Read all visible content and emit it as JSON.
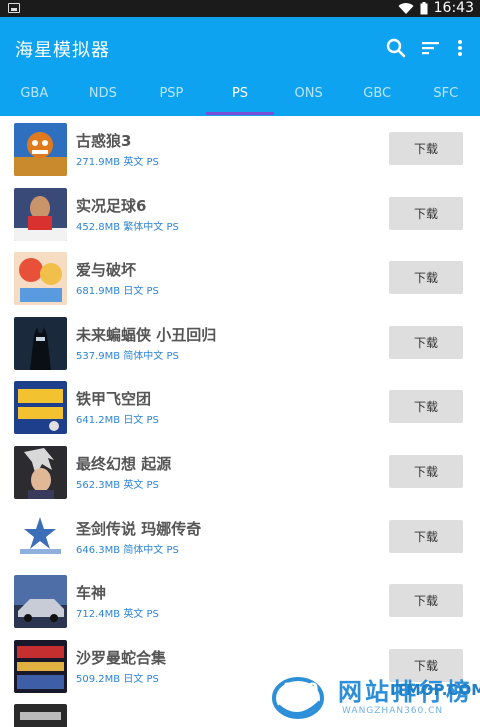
{
  "status_bar": {
    "time": "16:43"
  },
  "app_bar": {
    "title": "海星模拟器"
  },
  "tabs": [
    {
      "label": "GBA",
      "active": false
    },
    {
      "label": "NDS",
      "active": false
    },
    {
      "label": "PSP",
      "active": false
    },
    {
      "label": "PS",
      "active": true
    },
    {
      "label": "ONS",
      "active": false
    },
    {
      "label": "GBC",
      "active": false
    },
    {
      "label": "SFC",
      "active": false
    }
  ],
  "games": [
    {
      "name": "古惑狼3",
      "size": "271.9MB",
      "lang": "英文",
      "platform": "PS",
      "button": "下载"
    },
    {
      "name": "实况足球6",
      "size": "452.8MB",
      "lang": "繁体中文",
      "platform": "PS",
      "button": "下载"
    },
    {
      "name": "爱与破坏",
      "size": "681.9MB",
      "lang": "日文",
      "platform": "PS",
      "button": "下载"
    },
    {
      "name": "未来蝙蝠侠 小丑回归",
      "size": "537.9MB",
      "lang": "简体中文",
      "platform": "PS",
      "button": "下载"
    },
    {
      "name": "铁甲飞空团",
      "size": "641.2MB",
      "lang": "日文",
      "platform": "PS",
      "button": "下载"
    },
    {
      "name": "最终幻想 起源",
      "size": "562.3MB",
      "lang": "英文",
      "platform": "PS",
      "button": "下载"
    },
    {
      "name": "圣剑传说 玛娜传奇",
      "size": "646.3MB",
      "lang": "简体中文",
      "platform": "PS",
      "button": "下载"
    },
    {
      "name": "车神",
      "size": "712.4MB",
      "lang": "英文",
      "platform": "PS",
      "button": "下载"
    },
    {
      "name": "沙罗曼蛇合集",
      "size": "509.2MB",
      "lang": "日文",
      "platform": "PS",
      "button": "下载"
    }
  ],
  "watermark": {
    "logo_text": "360",
    "title": "网站排行榜",
    "subtitle": "WANGZHAN360.CN",
    "site": "ITMOP.COM"
  },
  "colors": {
    "app_bar": "#0ea3f0",
    "tab_indicator": "#7a4fd6",
    "meta_text": "#2c84d6",
    "button_bg": "#dedede"
  }
}
